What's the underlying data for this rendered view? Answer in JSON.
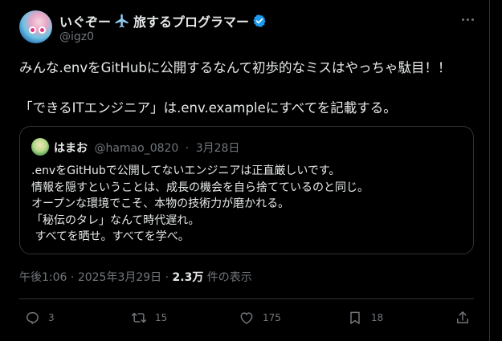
{
  "author": {
    "display_name_prefix": "いぐぞー",
    "display_name_suffix": "旅するプログラマー",
    "handle": "@igz0",
    "plane_emoji": "✈️"
  },
  "tweet": {
    "line1": "みんな.envをGitHubに公開するなんて初歩的なミスはやっちゃ駄目！！",
    "line2": "「できるITエンジニア」は.env.exampleにすべてを記載する。"
  },
  "quote": {
    "name": "はまお",
    "handle": "@hamao_0820",
    "date": "3月28日",
    "sep": "·",
    "lines": [
      ".envをGitHubで公開してないエンジニアは正直厳しいです。",
      "情報を隠すということは、成長の機会を自ら捨てているのと同じ。",
      "オープンな環境でこそ、本物の技術力が磨かれる。",
      "「秘伝のタレ」なんて時代遅れ。",
      " すべてを晒せ。すべてを学べ。"
    ]
  },
  "timestamp": {
    "time": "午後1:06",
    "sep": "·",
    "date": "2025年3月29日",
    "views_count": "2.3万",
    "views_label": "件の表示"
  },
  "actions": {
    "reply_count": "3",
    "retweet_count": "15",
    "like_count": "175",
    "bookmark_count": "18"
  },
  "colors": {
    "background": "#000000",
    "text": "#e7e9ea",
    "muted": "#71767b",
    "border": "#2f3336",
    "verified": "#1d9bf0"
  }
}
